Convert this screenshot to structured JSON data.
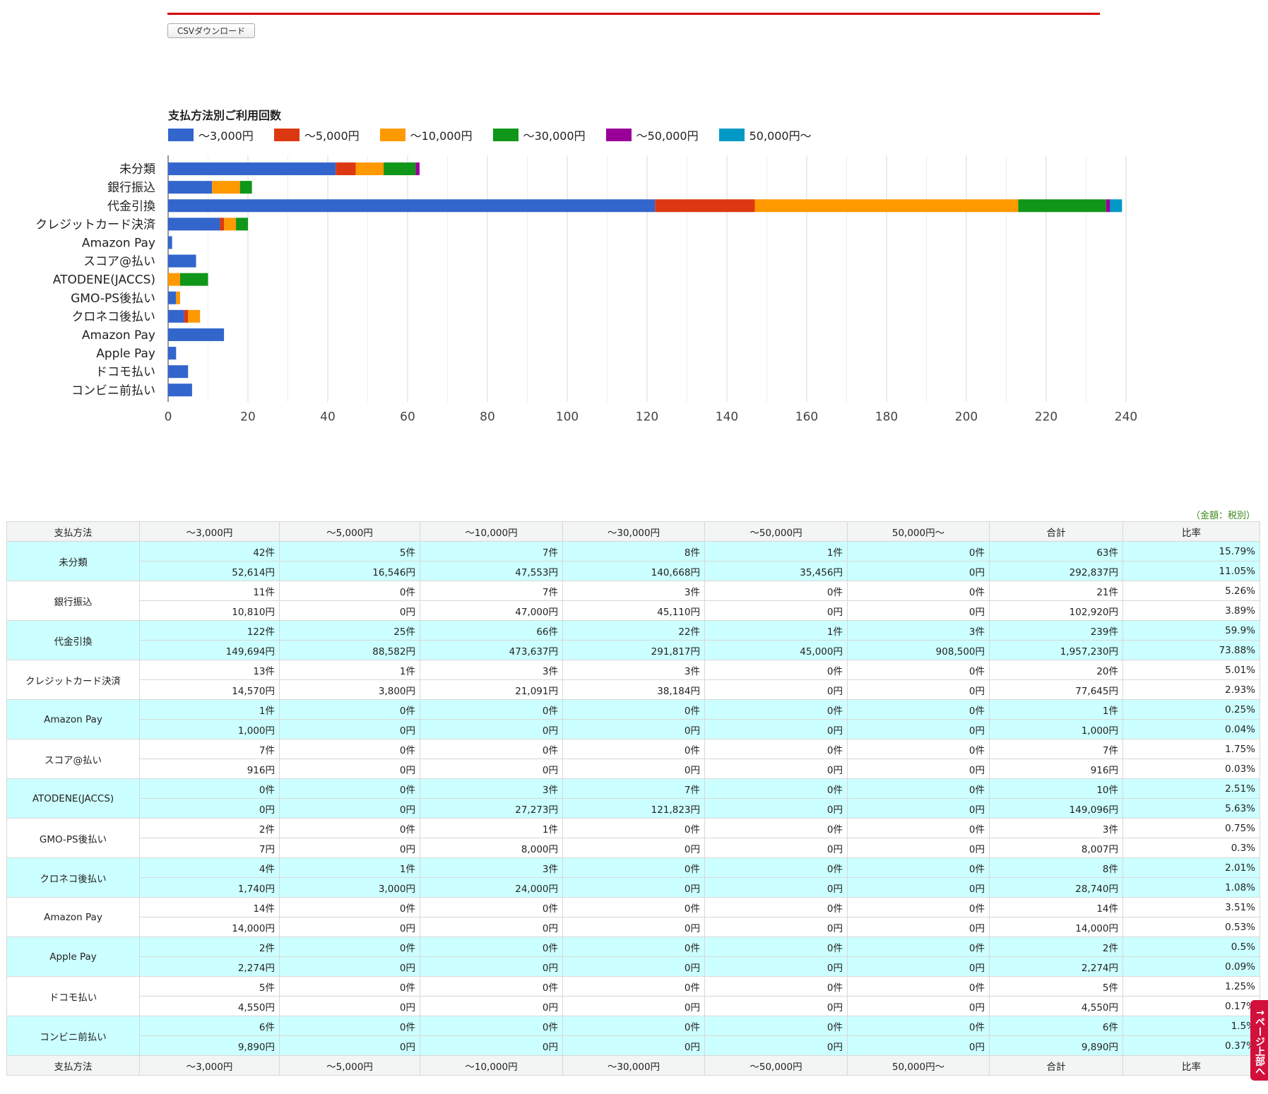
{
  "toolbar": {
    "csv_label": "CSVダウンロード"
  },
  "note": "（金額：税別）",
  "page_top": "↑ページ上部へ",
  "colors": [
    "#3366cc",
    "#dc3912",
    "#ff9900",
    "#109618",
    "#990099",
    "#0099c6"
  ],
  "chart_data": {
    "type": "bar",
    "orientation": "horizontal-stacked",
    "title": "支払方法別ご利用回数",
    "categories": [
      "未分類",
      "銀行振込",
      "代金引換",
      "クレジットカード決済",
      "Amazon Pay",
      "スコア@払い",
      "ATODENE(JACCS)",
      "GMO-PS後払い",
      "クロネコ後払い",
      "Amazon Pay",
      "Apple Pay",
      "ドコモ払い",
      "コンビニ前払い"
    ],
    "series": [
      {
        "name": "～3,000円",
        "values": [
          42,
          11,
          122,
          13,
          1,
          7,
          0,
          2,
          4,
          14,
          2,
          5,
          6
        ]
      },
      {
        "name": "～5,000円",
        "values": [
          5,
          0,
          25,
          1,
          0,
          0,
          0,
          0,
          1,
          0,
          0,
          0,
          0
        ]
      },
      {
        "name": "～10,000円",
        "values": [
          7,
          7,
          66,
          3,
          0,
          0,
          3,
          1,
          3,
          0,
          0,
          0,
          0
        ]
      },
      {
        "name": "～30,000円",
        "values": [
          8,
          3,
          22,
          3,
          0,
          0,
          7,
          0,
          0,
          0,
          0,
          0,
          0
        ]
      },
      {
        "name": "～50,000円",
        "values": [
          1,
          0,
          1,
          0,
          0,
          0,
          0,
          0,
          0,
          0,
          0,
          0,
          0
        ]
      },
      {
        "name": "50,000円～",
        "values": [
          0,
          0,
          3,
          0,
          0,
          0,
          0,
          0,
          0,
          0,
          0,
          0,
          0
        ]
      }
    ],
    "xlim": [
      0,
      240
    ],
    "xticks": [
      "0",
      "20",
      "40",
      "60",
      "80",
      "100",
      "120",
      "140",
      "160",
      "180",
      "200",
      "220",
      "240"
    ],
    "grid": true,
    "legend": "top"
  },
  "table": {
    "headers": [
      "支払方法",
      "～3,000円",
      "～5,000円",
      "～10,000円",
      "～30,000円",
      "～50,000円",
      "50,000円～",
      "合計",
      "比率"
    ],
    "rows": [
      {
        "method": "未分類",
        "counts": [
          "42件",
          "5件",
          "7件",
          "8件",
          "1件",
          "0件",
          "63件",
          "15.79%"
        ],
        "amounts": [
          "52,614円",
          "16,546円",
          "47,553円",
          "140,668円",
          "35,456円",
          "0円",
          "292,837円",
          "11.05%"
        ]
      },
      {
        "method": "銀行振込",
        "counts": [
          "11件",
          "0件",
          "7件",
          "3件",
          "0件",
          "0件",
          "21件",
          "5.26%"
        ],
        "amounts": [
          "10,810円",
          "0円",
          "47,000円",
          "45,110円",
          "0円",
          "0円",
          "102,920円",
          "3.89%"
        ]
      },
      {
        "method": "代金引換",
        "counts": [
          "122件",
          "25件",
          "66件",
          "22件",
          "1件",
          "3件",
          "239件",
          "59.9%"
        ],
        "amounts": [
          "149,694円",
          "88,582円",
          "473,637円",
          "291,817円",
          "45,000円",
          "908,500円",
          "1,957,230円",
          "73.88%"
        ]
      },
      {
        "method": "クレジットカード決済",
        "counts": [
          "13件",
          "1件",
          "3件",
          "3件",
          "0件",
          "0件",
          "20件",
          "5.01%"
        ],
        "amounts": [
          "14,570円",
          "3,800円",
          "21,091円",
          "38,184円",
          "0円",
          "0円",
          "77,645円",
          "2.93%"
        ]
      },
      {
        "method": "Amazon Pay",
        "counts": [
          "1件",
          "0件",
          "0件",
          "0件",
          "0件",
          "0件",
          "1件",
          "0.25%"
        ],
        "amounts": [
          "1,000円",
          "0円",
          "0円",
          "0円",
          "0円",
          "0円",
          "1,000円",
          "0.04%"
        ]
      },
      {
        "method": "スコア@払い",
        "counts": [
          "7件",
          "0件",
          "0件",
          "0件",
          "0件",
          "0件",
          "7件",
          "1.75%"
        ],
        "amounts": [
          "916円",
          "0円",
          "0円",
          "0円",
          "0円",
          "0円",
          "916円",
          "0.03%"
        ]
      },
      {
        "method": "ATODENE(JACCS)",
        "counts": [
          "0件",
          "0件",
          "3件",
          "7件",
          "0件",
          "0件",
          "10件",
          "2.51%"
        ],
        "amounts": [
          "0円",
          "0円",
          "27,273円",
          "121,823円",
          "0円",
          "0円",
          "149,096円",
          "5.63%"
        ]
      },
      {
        "method": "GMO-PS後払い",
        "counts": [
          "2件",
          "0件",
          "1件",
          "0件",
          "0件",
          "0件",
          "3件",
          "0.75%"
        ],
        "amounts": [
          "7円",
          "0円",
          "8,000円",
          "0円",
          "0円",
          "0円",
          "8,007円",
          "0.3%"
        ]
      },
      {
        "method": "クロネコ後払い",
        "counts": [
          "4件",
          "1件",
          "3件",
          "0件",
          "0件",
          "0件",
          "8件",
          "2.01%"
        ],
        "amounts": [
          "1,740円",
          "3,000円",
          "24,000円",
          "0円",
          "0円",
          "0円",
          "28,740円",
          "1.08%"
        ]
      },
      {
        "method": "Amazon Pay",
        "counts": [
          "14件",
          "0件",
          "0件",
          "0件",
          "0件",
          "0件",
          "14件",
          "3.51%"
        ],
        "amounts": [
          "14,000円",
          "0円",
          "0円",
          "0円",
          "0円",
          "0円",
          "14,000円",
          "0.53%"
        ]
      },
      {
        "method": "Apple Pay",
        "counts": [
          "2件",
          "0件",
          "0件",
          "0件",
          "0件",
          "0件",
          "2件",
          "0.5%"
        ],
        "amounts": [
          "2,274円",
          "0円",
          "0円",
          "0円",
          "0円",
          "0円",
          "2,274円",
          "0.09%"
        ]
      },
      {
        "method": "ドコモ払い",
        "counts": [
          "5件",
          "0件",
          "0件",
          "0件",
          "0件",
          "0件",
          "5件",
          "1.25%"
        ],
        "amounts": [
          "4,550円",
          "0円",
          "0円",
          "0円",
          "0円",
          "0円",
          "4,550円",
          "0.17%"
        ]
      },
      {
        "method": "コンビニ前払い",
        "counts": [
          "6件",
          "0件",
          "0件",
          "0件",
          "0件",
          "0件",
          "6件",
          "1.5%"
        ],
        "amounts": [
          "9,890円",
          "0円",
          "0円",
          "0円",
          "0円",
          "0円",
          "9,890円",
          "0.37%"
        ]
      }
    ]
  }
}
